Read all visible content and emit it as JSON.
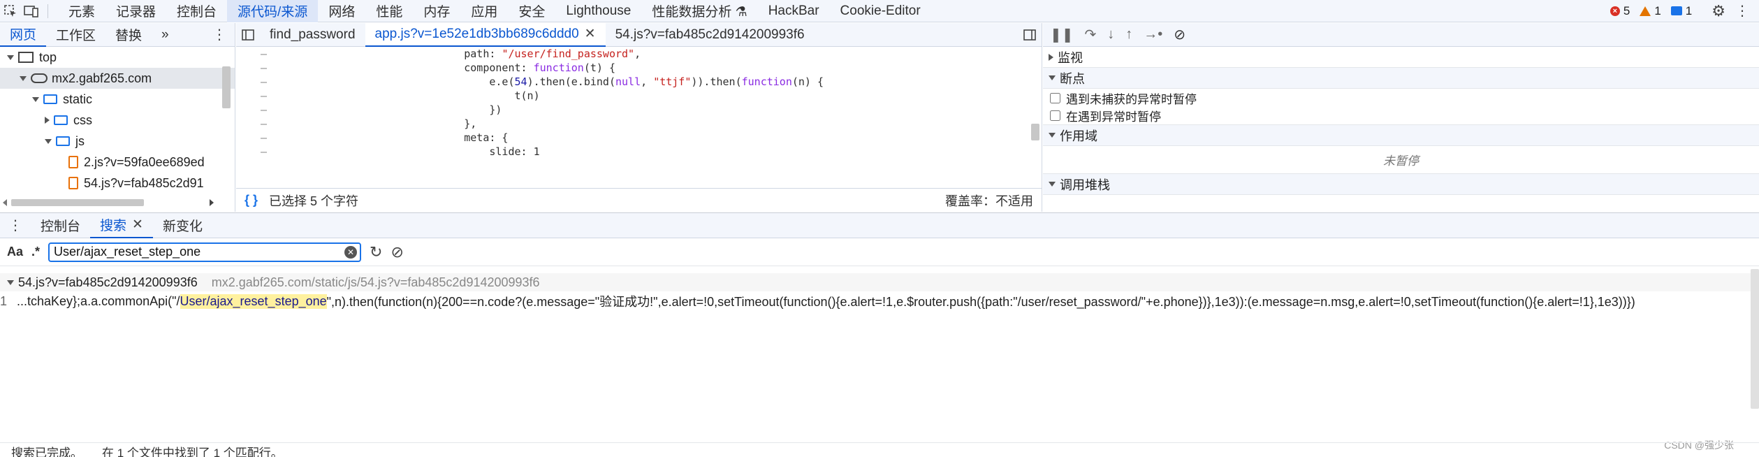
{
  "toolbar": {
    "tabs": [
      "元素",
      "记录器",
      "控制台",
      "源代码/来源",
      "网络",
      "性能",
      "内存",
      "应用",
      "安全",
      "Lighthouse",
      "性能数据分析 ⚗",
      "HackBar",
      "Cookie-Editor"
    ],
    "active_tab": "源代码/来源",
    "errors": "5",
    "warnings": "1",
    "messages": "1"
  },
  "navigator": {
    "tabs": [
      "网页",
      "工作区",
      "替换"
    ],
    "more": "»",
    "tree": [
      {
        "label": "top",
        "kind": "frame",
        "indent": 0,
        "expanded": true
      },
      {
        "label": "mx2.gabf265.com",
        "kind": "domain",
        "indent": 1,
        "expanded": true,
        "selected": true
      },
      {
        "label": "static",
        "kind": "folder",
        "indent": 2,
        "expanded": true
      },
      {
        "label": "css",
        "kind": "folder",
        "indent": 3,
        "expanded": false
      },
      {
        "label": "js",
        "kind": "folder",
        "indent": 3,
        "expanded": true
      },
      {
        "label": "2.js?v=59fa0ee689ed",
        "kind": "file",
        "indent": 4
      },
      {
        "label": "54.js?v=fab485c2d91",
        "kind": "file",
        "indent": 4
      }
    ]
  },
  "editor": {
    "tabs": [
      "find_password",
      "app.js?v=1e52e1db3bb689c6ddd0",
      "54.js?v=fab485c2d914200993f6"
    ],
    "active_tab": "app.js?v=1e52e1db3bb689c6ddd0",
    "status_left": "已选择 5 个字符",
    "coverage": "覆盖率：不适用",
    "gutter_mark": "–"
  },
  "debugger": {
    "watch": "监视",
    "breakpoints": "断点",
    "pause_uncaught": "遇到未捕获的异常时暂停",
    "pause_caught": "在遇到异常时暂停",
    "scope": "作用域",
    "not_paused": "未暂停",
    "call_stack": "调用堆栈"
  },
  "drawer": {
    "tabs": [
      "控制台",
      "搜索",
      "新变化"
    ],
    "active_tab": "搜索",
    "case_label": "Aa",
    "regex_label": ".*",
    "search_value": "User/ajax_reset_step_one",
    "result_file": "54.js?v=fab485c2d914200993f6",
    "result_path": "mx2.gabf265.com/static/js/54.js?v=fab485c2d914200993f6",
    "result_line_no": "1",
    "result_pre": "...tchaKey};a.a.commonApi(\"/",
    "result_match": "User/ajax_reset_step_one",
    "result_post": "\",n).then(function(n){200==n.code?(e.message=\"验证成功!\",e.alert=!0,setTimeout(function(){e.alert=!1,e.$router.push({path:\"/user/reset_password/\"+e.phone})},1e3)):(e.message=n.msg,e.alert=!0,setTimeout(function(){e.alert=!1},1e3))})",
    "status_done": "搜索已完成。",
    "status_found": "在 1 个文件中找到了 1 个匹配行。"
  },
  "watermark": "CSDN @强少张"
}
